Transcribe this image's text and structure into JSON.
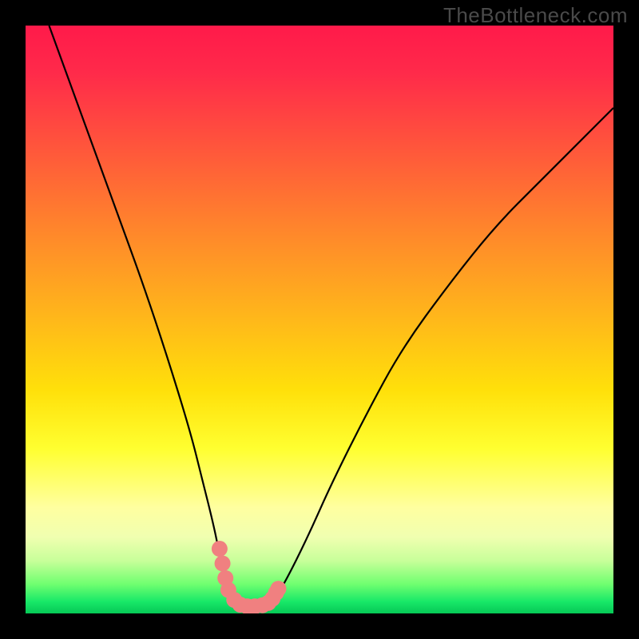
{
  "watermark": "TheBottleneck.com",
  "chart_data": {
    "type": "line",
    "title": "",
    "xlabel": "",
    "ylabel": "",
    "xlim": [
      0,
      100
    ],
    "ylim": [
      0,
      100
    ],
    "background_gradient": {
      "stops": [
        {
          "pos": 0.0,
          "color": "#ff1a4a"
        },
        {
          "pos": 0.22,
          "color": "#ff5a3a"
        },
        {
          "pos": 0.5,
          "color": "#ffb81a"
        },
        {
          "pos": 0.72,
          "color": "#ffff30"
        },
        {
          "pos": 0.91,
          "color": "#c8ff9a"
        },
        {
          "pos": 1.0,
          "color": "#06c856"
        }
      ]
    },
    "series": [
      {
        "name": "left-curve",
        "color": "#000000",
        "x": [
          4,
          8,
          12,
          16,
          20,
          24,
          28,
          30,
          32,
          33,
          34,
          35,
          36
        ],
        "values": [
          100,
          89,
          78,
          67,
          56,
          44,
          31,
          23,
          15,
          10,
          6,
          4,
          2
        ]
      },
      {
        "name": "right-curve",
        "color": "#000000",
        "x": [
          42,
          44,
          48,
          52,
          58,
          64,
          72,
          80,
          88,
          96,
          100
        ],
        "values": [
          2,
          5,
          13,
          22,
          34,
          45,
          56,
          66,
          74,
          82,
          86
        ]
      },
      {
        "name": "floor",
        "color": "#000000",
        "x": [
          36,
          38,
          40,
          42
        ],
        "values": [
          2,
          1,
          1,
          2
        ]
      }
    ],
    "markers": {
      "name": "highlight-dots",
      "color": "#f08080",
      "size": 20,
      "points": [
        {
          "x": 33.0,
          "y": 11.0
        },
        {
          "x": 33.5,
          "y": 8.5
        },
        {
          "x": 34.0,
          "y": 6.0
        },
        {
          "x": 34.5,
          "y": 4.0
        },
        {
          "x": 35.5,
          "y": 2.3
        },
        {
          "x": 36.5,
          "y": 1.5
        },
        {
          "x": 37.7,
          "y": 1.2
        },
        {
          "x": 39.0,
          "y": 1.2
        },
        {
          "x": 40.3,
          "y": 1.4
        },
        {
          "x": 41.3,
          "y": 1.8
        },
        {
          "x": 42.0,
          "y": 2.5
        },
        {
          "x": 42.6,
          "y": 3.5
        },
        {
          "x": 43.0,
          "y": 4.2
        }
      ]
    }
  }
}
